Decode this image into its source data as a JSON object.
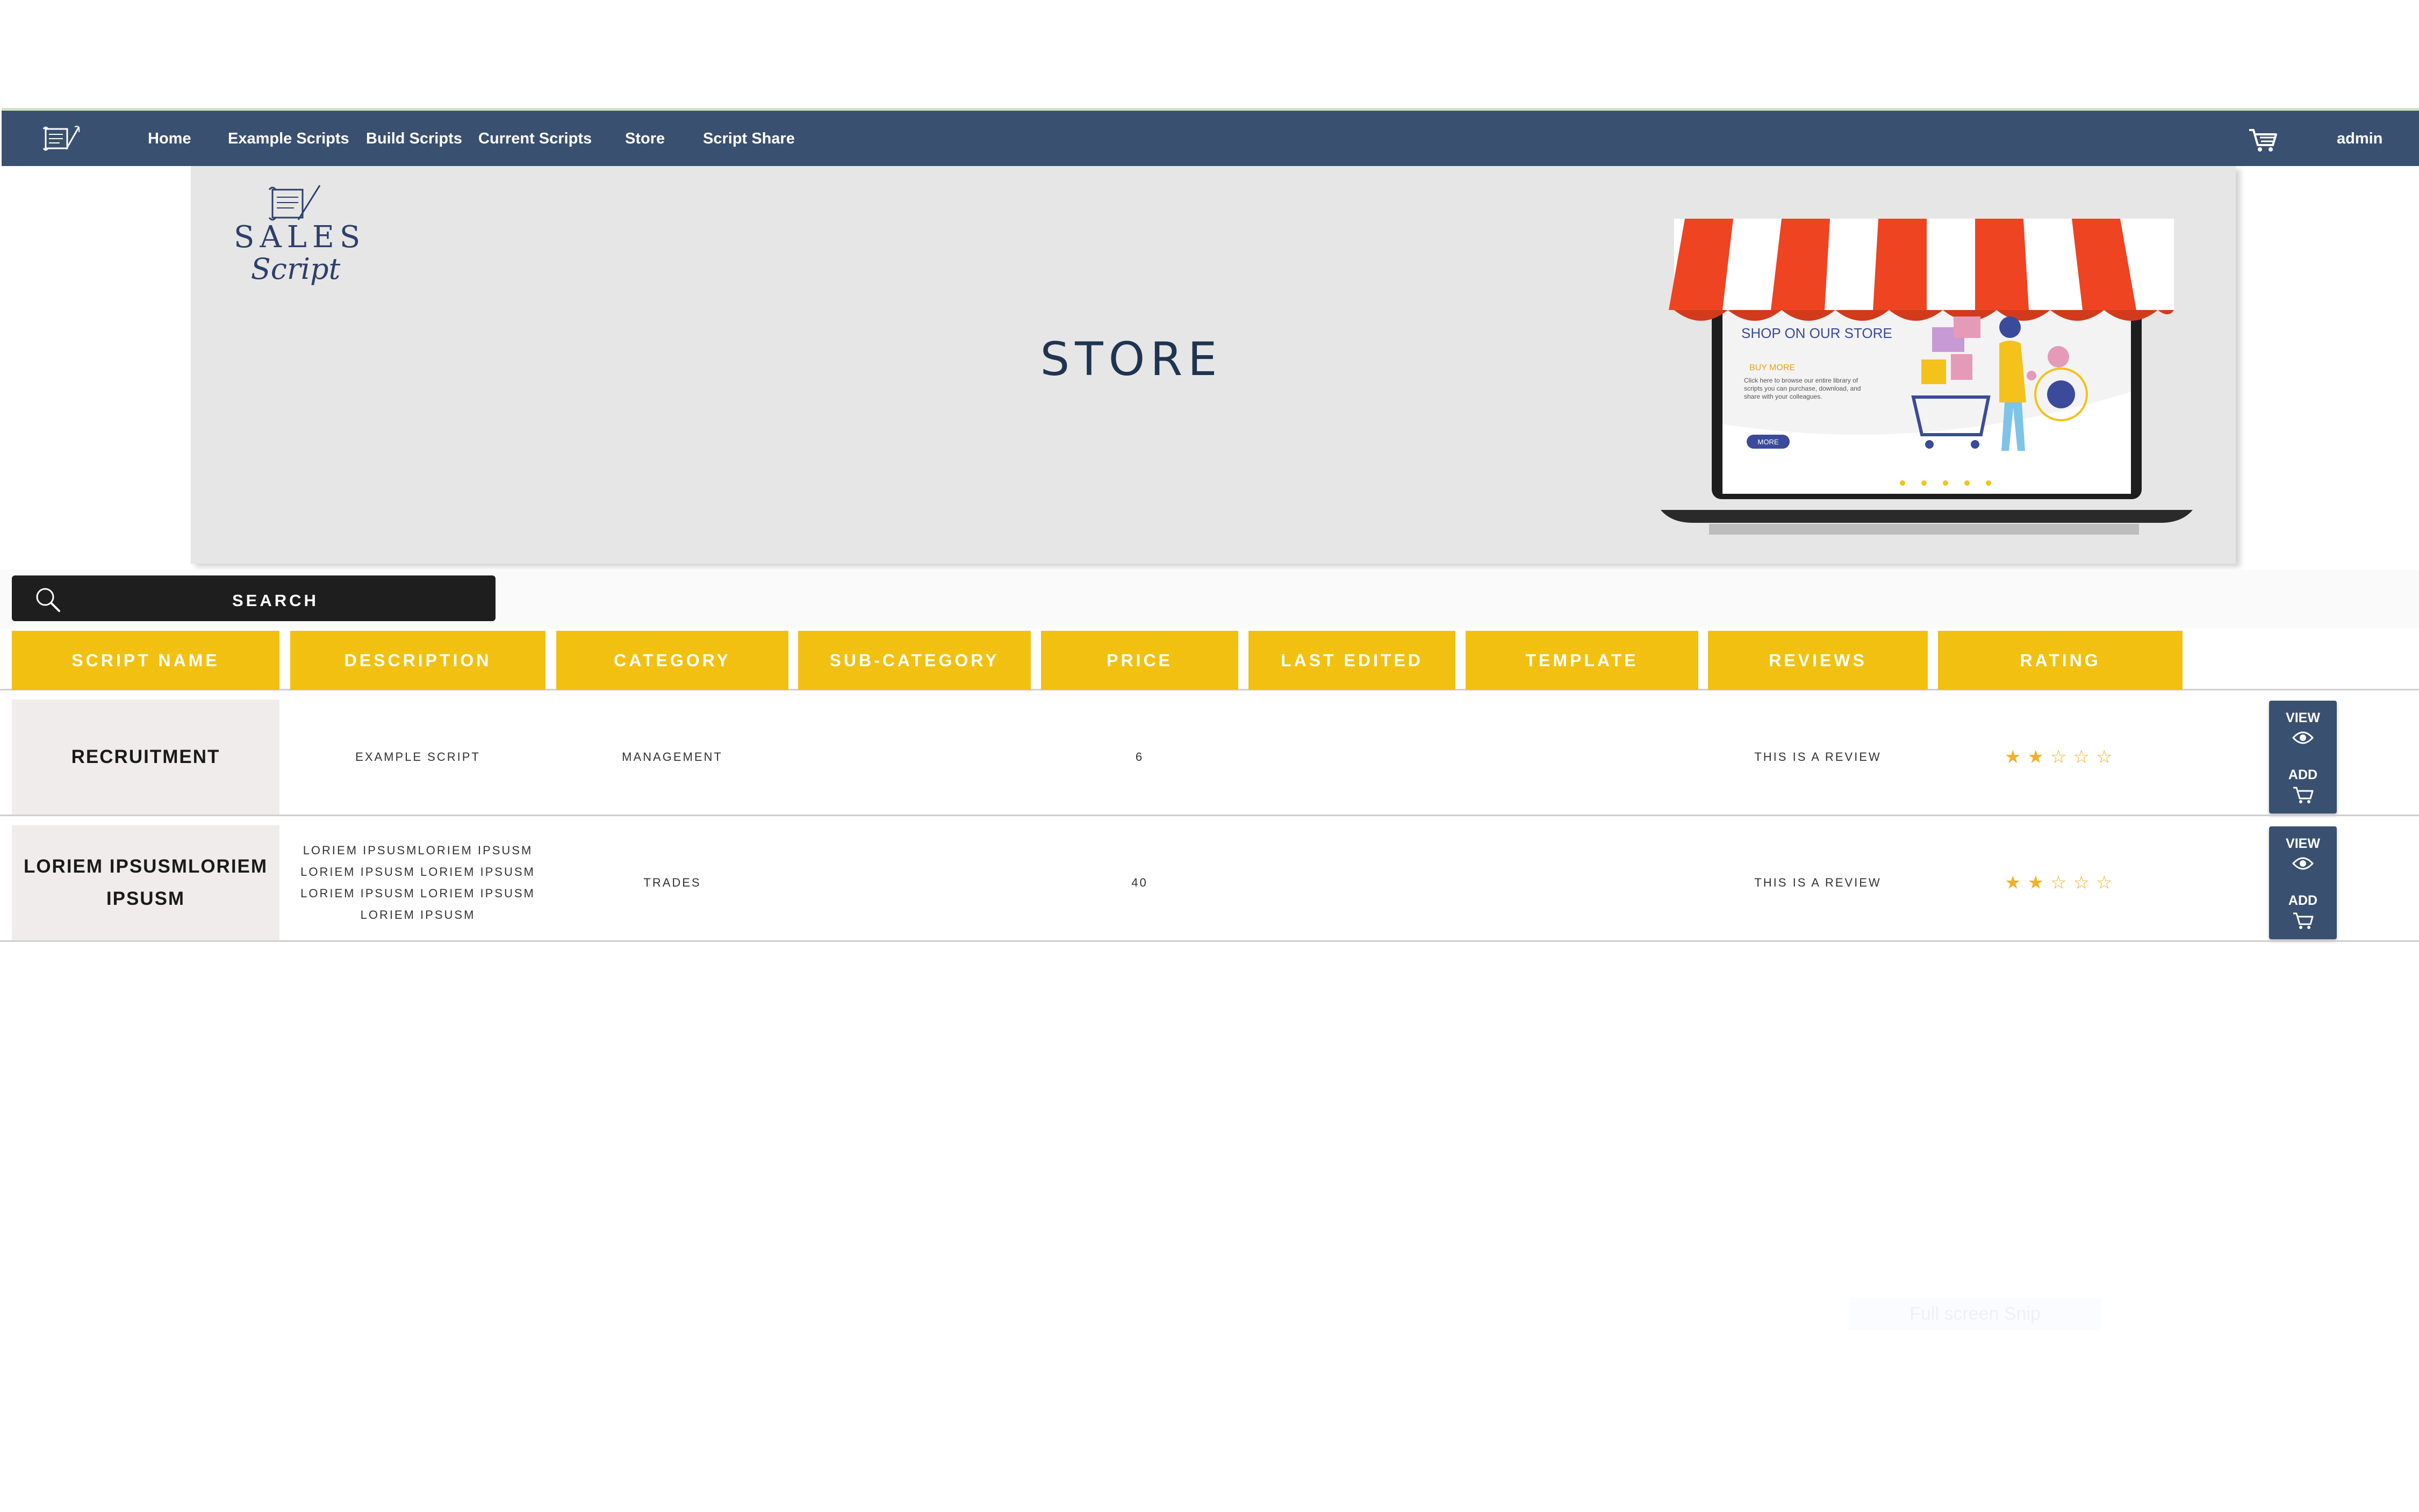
{
  "nav": {
    "items": [
      "Home",
      "Example Scripts",
      "Build Scripts",
      "Current Scripts",
      "Store",
      "Script Share"
    ],
    "user": "admin",
    "logo_icon": "scroll-quill-icon",
    "cart_icon": "cart-icon"
  },
  "hero": {
    "title": "STORE",
    "logo_word": "SALES",
    "logo_script": "Script",
    "illustration": {
      "heading": "SHOP ON OUR STORE",
      "buy_more": "BUY MORE",
      "body": "Click here to browse our entire library of scripts you can purchase, download, and share with your colleagues.",
      "button": "MORE"
    }
  },
  "search": {
    "label": "SEARCH",
    "icon": "search-icon"
  },
  "table": {
    "headers": [
      "SCRIPT NAME",
      "DESCRIPTION",
      "CATEGORY",
      "SUB-CATEGORY",
      "PRICE",
      "LAST EDITED",
      "TEMPLATE",
      "REVIEWS",
      "RATING"
    ],
    "rows": [
      {
        "name": "RECRUITMENT",
        "description": "EXAMPLE SCRIPT",
        "category": "MANAGEMENT",
        "sub_category": "",
        "price": "6",
        "last_edited": "",
        "template": "",
        "reviews": "THIS IS A REVIEW",
        "rating": 2,
        "rating_max": 5
      },
      {
        "name": "LORIEM IPSUSMLORIEM IPSUSM",
        "description": "LORIEM IPSUSMLORIEM IPSUSM LORIEM IPSUSM LORIEM IPSUSM LORIEM IPSUSM LORIEM IPSUSM LORIEM IPSUSM",
        "category": "TRADES",
        "sub_category": "",
        "price": "40",
        "last_edited": "",
        "template": "",
        "reviews": "THIS IS A REVIEW",
        "rating": 2,
        "rating_max": 5
      }
    ],
    "actions": {
      "view_label": "VIEW",
      "add_label": "ADD",
      "view_icon": "eye-icon",
      "add_icon": "cart-icon"
    }
  },
  "overlay": {
    "watermark": "Full screen Snip"
  },
  "colors": {
    "nav_bg": "#3a5070",
    "header_yellow": "#f2c010",
    "star": "#f2b12a",
    "hero_bg": "#e6e6e6",
    "title": "#1f3450"
  }
}
